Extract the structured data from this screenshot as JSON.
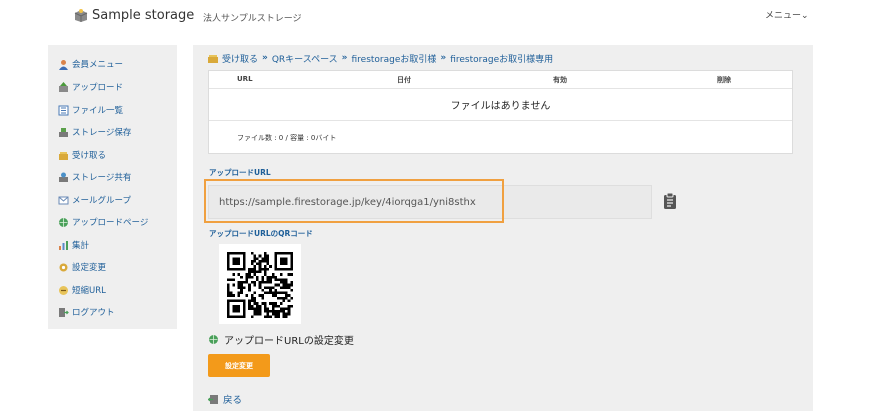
{
  "header": {
    "app_title": "Sample storage",
    "company_subtitle": "法人サンプルストレージ",
    "menu_label": "メニュー⌄"
  },
  "sidebar": {
    "items": [
      {
        "label": "会員メニュー",
        "icon": "member-icon"
      },
      {
        "label": "アップロード",
        "icon": "upload-icon"
      },
      {
        "label": "ファイル一覧",
        "icon": "file-list-icon"
      },
      {
        "label": "ストレージ保存",
        "icon": "storage-save-icon"
      },
      {
        "label": "受け取る",
        "icon": "receive-icon"
      },
      {
        "label": "ストレージ共有",
        "icon": "storage-share-icon"
      },
      {
        "label": "メールグループ",
        "icon": "mail-group-icon"
      },
      {
        "label": "アップロードページ",
        "icon": "upload-page-icon"
      },
      {
        "label": "集計",
        "icon": "stats-icon"
      },
      {
        "label": "設定変更",
        "icon": "settings-icon"
      },
      {
        "label": "短縮URL",
        "icon": "short-url-icon"
      },
      {
        "label": "ログアウト",
        "icon": "logout-icon"
      }
    ]
  },
  "breadcrumb": {
    "items": [
      "受け取る",
      "QRキースペース",
      "firestorageお取引様",
      "firestorageお取引様専用"
    ],
    "separator": "»"
  },
  "file_table": {
    "headers": [
      "URL",
      "日付",
      "有効",
      "削除"
    ],
    "empty_message": "ファイルはありません",
    "summary": "ファイル数 : 0 / 容量 : 0バイト"
  },
  "upload_url": {
    "label": "アップロードURL",
    "value": "https://sample.firestorage.jp/key/4iorqga1/yni8sthx"
  },
  "qr": {
    "label": "アップロードURLのQRコード"
  },
  "settings_link": {
    "label": "アップロードURLの設定変更"
  },
  "settings_button": {
    "label": "設定変更"
  },
  "back_link": {
    "label": "戻る"
  },
  "colors": {
    "link": "#1f5f99",
    "accent_orange": "#f39a1a",
    "highlight_border": "#f0a040",
    "panel_bg": "#efefef"
  }
}
